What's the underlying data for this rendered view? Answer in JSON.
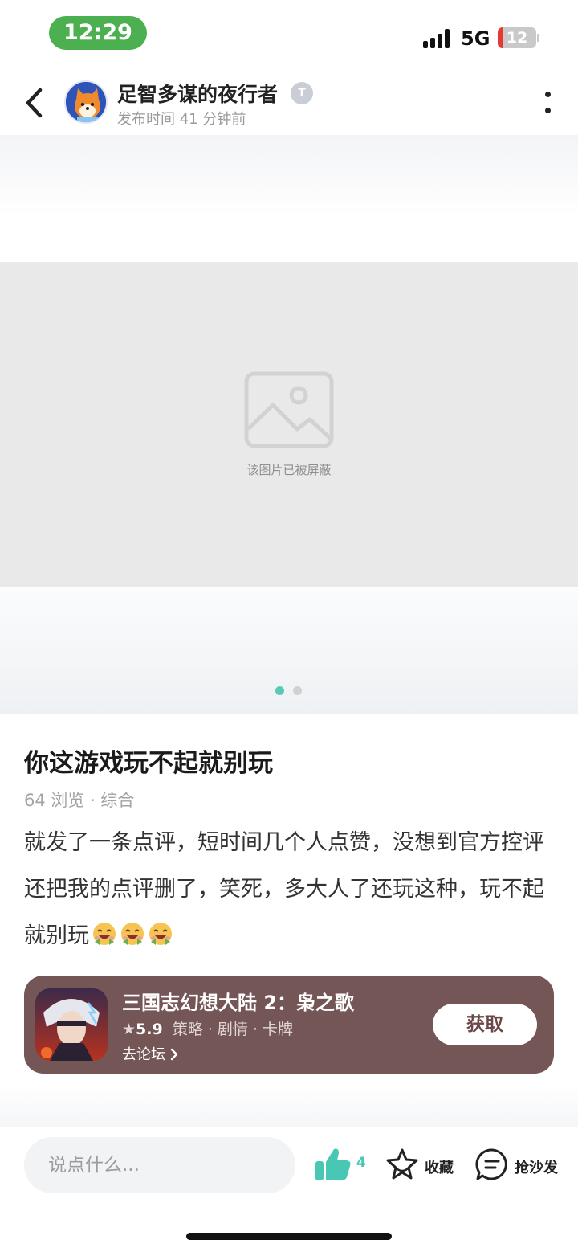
{
  "status_bar": {
    "time": "12:29",
    "network": "5G",
    "battery_level": "12"
  },
  "header": {
    "author_name": "足智多谋的夜行者",
    "badge": "T",
    "post_time": "发布时间 41 分钟前"
  },
  "media": {
    "blocked_text": "该图片已被屏蔽",
    "pages": 2,
    "current_page": 1,
    "accent_color": "#5cc9b6",
    "inactive_color": "#d0d0d0"
  },
  "post": {
    "title": "你这游戏玩不起就别玩",
    "meta": "64 浏览 · 综合",
    "body": "就发了一条点评，短时间几个人点赞，没想到官方控评还把我的点评删了，笑死，多大人了还玩这种，玩不起就别玩"
  },
  "game_card": {
    "name": "三国志幻想大陆 2：枭之歌",
    "rating": "5.9",
    "tags": "策略 · 剧情 · 卡牌",
    "forum_link": "去论坛",
    "get_button": "获取",
    "background_color": "#745656"
  },
  "bottom_bar": {
    "comment_placeholder": "说点什么...",
    "like_count": "4",
    "favorite_label": "收藏",
    "sofa_label": "抢沙发",
    "like_color": "#49c7b5"
  }
}
